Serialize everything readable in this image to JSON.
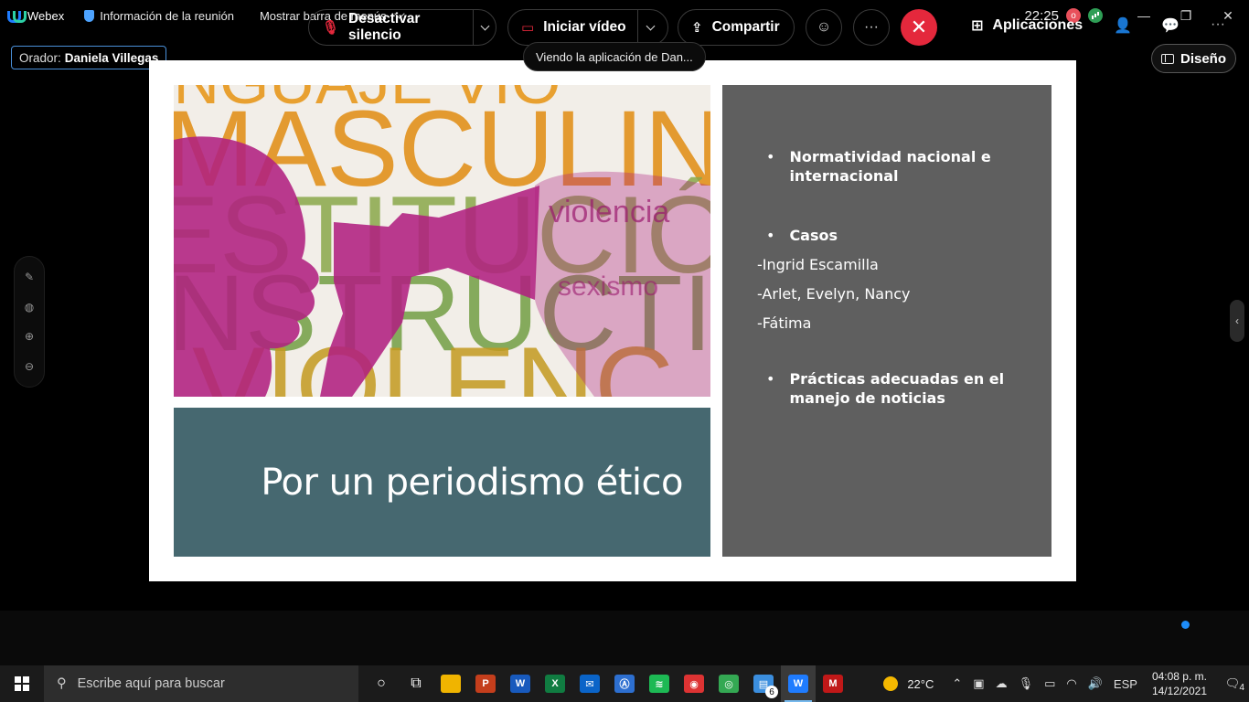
{
  "topbar": {
    "app_name": "Webex",
    "meeting_info": "Información de la reunión",
    "show_menu_bar": "Mostrar barra de menús",
    "clock": "22:25",
    "rec_label": "o"
  },
  "speaker": {
    "prefix": "Orador:",
    "name": "Daniela Villegas"
  },
  "viewing_banner": "Viendo la aplicación de Dan...",
  "layout_button": "Diseño",
  "slide": {
    "art_words": [
      "MASCULIN",
      "ESTITUCIÓN",
      "INSTRUCTIVAM",
      "VIOLENC"
    ],
    "title": "Por un periodismo ético",
    "bullets": [
      {
        "type": "bullet",
        "text": "Normatividad nacional e internacional"
      },
      {
        "type": "bullet",
        "text": "Casos"
      },
      {
        "type": "plain",
        "text": "-Ingrid Escamilla"
      },
      {
        "type": "plain",
        "text": "-Arlet, Evelyn, Nancy"
      },
      {
        "type": "plain",
        "text": "-Fátima"
      },
      {
        "type": "bullet",
        "text": "Prácticas adecuadas en el manejo de noticias"
      }
    ],
    "colors": {
      "title_bg": "#466870",
      "side_bg": "#5f5f5f",
      "magenta": "#b0207f"
    }
  },
  "controls": {
    "mute": "Desactivar silencio",
    "video": "Iniciar vídeo",
    "share": "Compartir",
    "more": "···",
    "apps": "Aplicaciones",
    "overflow": "···"
  },
  "taskbar": {
    "search_placeholder": "Escribe aquí para buscar",
    "apps": [
      {
        "name": "file-explorer",
        "label": "",
        "color": "#f0b400"
      },
      {
        "name": "powerpoint",
        "label": "P",
        "color": "#c43e1c"
      },
      {
        "name": "word",
        "label": "W",
        "color": "#185abd"
      },
      {
        "name": "excel",
        "label": "X",
        "color": "#107c41"
      },
      {
        "name": "mail",
        "label": "✉",
        "color": "#0a64c8"
      },
      {
        "name": "editor",
        "label": "Ⓐ",
        "color": "#2d6fd0"
      },
      {
        "name": "spotify",
        "label": "≋",
        "color": "#1db954"
      },
      {
        "name": "headset-app",
        "label": "◉",
        "color": "#d33"
      },
      {
        "name": "chrome",
        "label": "◎",
        "color": "#34a853"
      },
      {
        "name": "notepad",
        "label": "▤",
        "color": "#3b8ede",
        "badge": "6"
      },
      {
        "name": "webex",
        "label": "W",
        "color": "#1f7cff",
        "active": true
      },
      {
        "name": "mcafee",
        "label": "M",
        "color": "#c01818"
      }
    ],
    "weather": "22°C",
    "language": "ESP",
    "time": "04:08 p. m.",
    "date": "14/12/2021",
    "notifications": "4"
  }
}
